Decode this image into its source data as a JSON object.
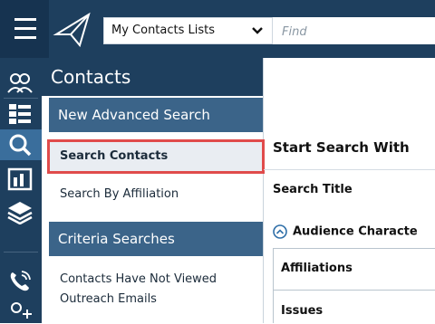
{
  "header": {
    "contact_list_select": "My Contacts Lists",
    "find_placeholder": "Find"
  },
  "sidebar": {
    "title": "Contacts",
    "sections": [
      {
        "label": "New Advanced Search"
      },
      {
        "label": "Criteria Searches"
      }
    ],
    "links": [
      {
        "label": "Search Contacts",
        "selected": true
      },
      {
        "label": "Search By Affiliation",
        "selected": false
      },
      {
        "label": "Contacts Have Not Viewed Outreach Emails",
        "selected": false
      }
    ]
  },
  "icon_rail": [
    "people-icon",
    "list-layout-icon",
    "search-icon",
    "bar-chart-icon",
    "layers-icon",
    "phone-icon",
    "add-person-icon"
  ],
  "main": {
    "heading": "Start Search With",
    "search_title_label": "Search Title",
    "audience_section": "Audience Characte",
    "criteria": [
      "Affiliations",
      "Issues"
    ]
  },
  "colors": {
    "navy": "#1e3f5e",
    "section_blue": "#3b6489",
    "highlight_red": "#e04b4b",
    "selected_bg": "#e9edf2"
  }
}
